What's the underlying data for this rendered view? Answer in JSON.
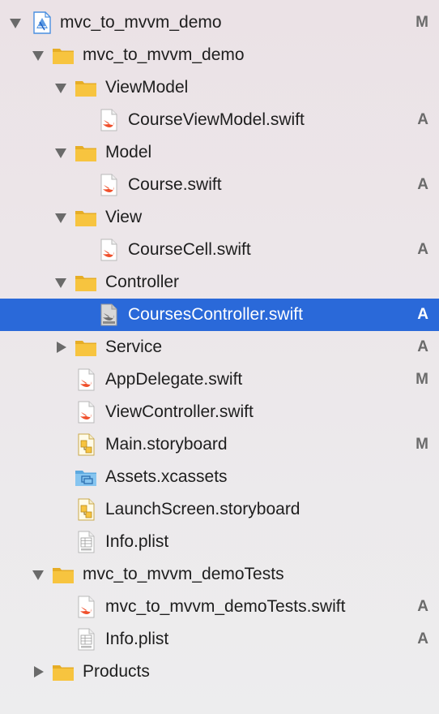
{
  "navigator": {
    "rows": [
      {
        "id": "project",
        "label": "mvc_to_mvvm_demo",
        "icon": "xcode-project-icon",
        "disclosure": "expanded",
        "badge": "M"
      },
      {
        "id": "group-app",
        "label": "mvc_to_mvvm_demo",
        "icon": "folder-icon",
        "disclosure": "expanded",
        "badge": ""
      },
      {
        "id": "group-viewmodel",
        "label": "ViewModel",
        "icon": "folder-icon",
        "disclosure": "expanded",
        "badge": ""
      },
      {
        "id": "file-courseviewmodel",
        "label": "CourseViewModel.swift",
        "icon": "swift-file-icon",
        "disclosure": "none",
        "badge": "A"
      },
      {
        "id": "group-model",
        "label": "Model",
        "icon": "folder-icon",
        "disclosure": "expanded",
        "badge": ""
      },
      {
        "id": "file-course",
        "label": "Course.swift",
        "icon": "swift-file-icon",
        "disclosure": "none",
        "badge": "A"
      },
      {
        "id": "group-view",
        "label": "View",
        "icon": "folder-icon",
        "disclosure": "expanded",
        "badge": ""
      },
      {
        "id": "file-coursecell",
        "label": "CourseCell.swift",
        "icon": "swift-file-icon",
        "disclosure": "none",
        "badge": "A"
      },
      {
        "id": "group-controller",
        "label": "Controller",
        "icon": "folder-icon",
        "disclosure": "expanded",
        "badge": ""
      },
      {
        "id": "file-coursescontroller",
        "label": "CoursesController.swift",
        "icon": "swift-file-icon",
        "disclosure": "none",
        "badge": "A",
        "selected": true
      },
      {
        "id": "group-service",
        "label": "Service",
        "icon": "folder-icon",
        "disclosure": "collapsed",
        "badge": "A"
      },
      {
        "id": "file-appdelegate",
        "label": "AppDelegate.swift",
        "icon": "swift-file-icon",
        "disclosure": "none",
        "badge": "M"
      },
      {
        "id": "file-viewcontroller",
        "label": "ViewController.swift",
        "icon": "swift-file-icon",
        "disclosure": "none",
        "badge": ""
      },
      {
        "id": "file-main-storyboard",
        "label": "Main.storyboard",
        "icon": "storyboard-file-icon",
        "disclosure": "none",
        "badge": "M"
      },
      {
        "id": "file-assets",
        "label": "Assets.xcassets",
        "icon": "asset-catalog-icon",
        "disclosure": "none",
        "badge": ""
      },
      {
        "id": "file-launchscreen",
        "label": "LaunchScreen.storyboard",
        "icon": "storyboard-file-icon",
        "disclosure": "none",
        "badge": ""
      },
      {
        "id": "file-infoplist",
        "label": "Info.plist",
        "icon": "plist-file-icon",
        "disclosure": "none",
        "badge": ""
      },
      {
        "id": "group-tests",
        "label": "mvc_to_mvvm_demoTests",
        "icon": "folder-icon",
        "disclosure": "expanded",
        "badge": ""
      },
      {
        "id": "file-tests-swift",
        "label": "mvc_to_mvvm_demoTests.swift",
        "icon": "swift-file-icon",
        "disclosure": "none",
        "badge": "A"
      },
      {
        "id": "file-tests-infoplist",
        "label": "Info.plist",
        "icon": "plist-file-icon",
        "disclosure": "none",
        "badge": "A"
      },
      {
        "id": "group-products",
        "label": "Products",
        "icon": "folder-icon",
        "disclosure": "collapsed",
        "badge": ""
      }
    ]
  },
  "colors": {
    "selection": "#2a69d9",
    "folder": "#f7c43f",
    "swift": "#f0512d",
    "badge": "#6b6b6b"
  }
}
